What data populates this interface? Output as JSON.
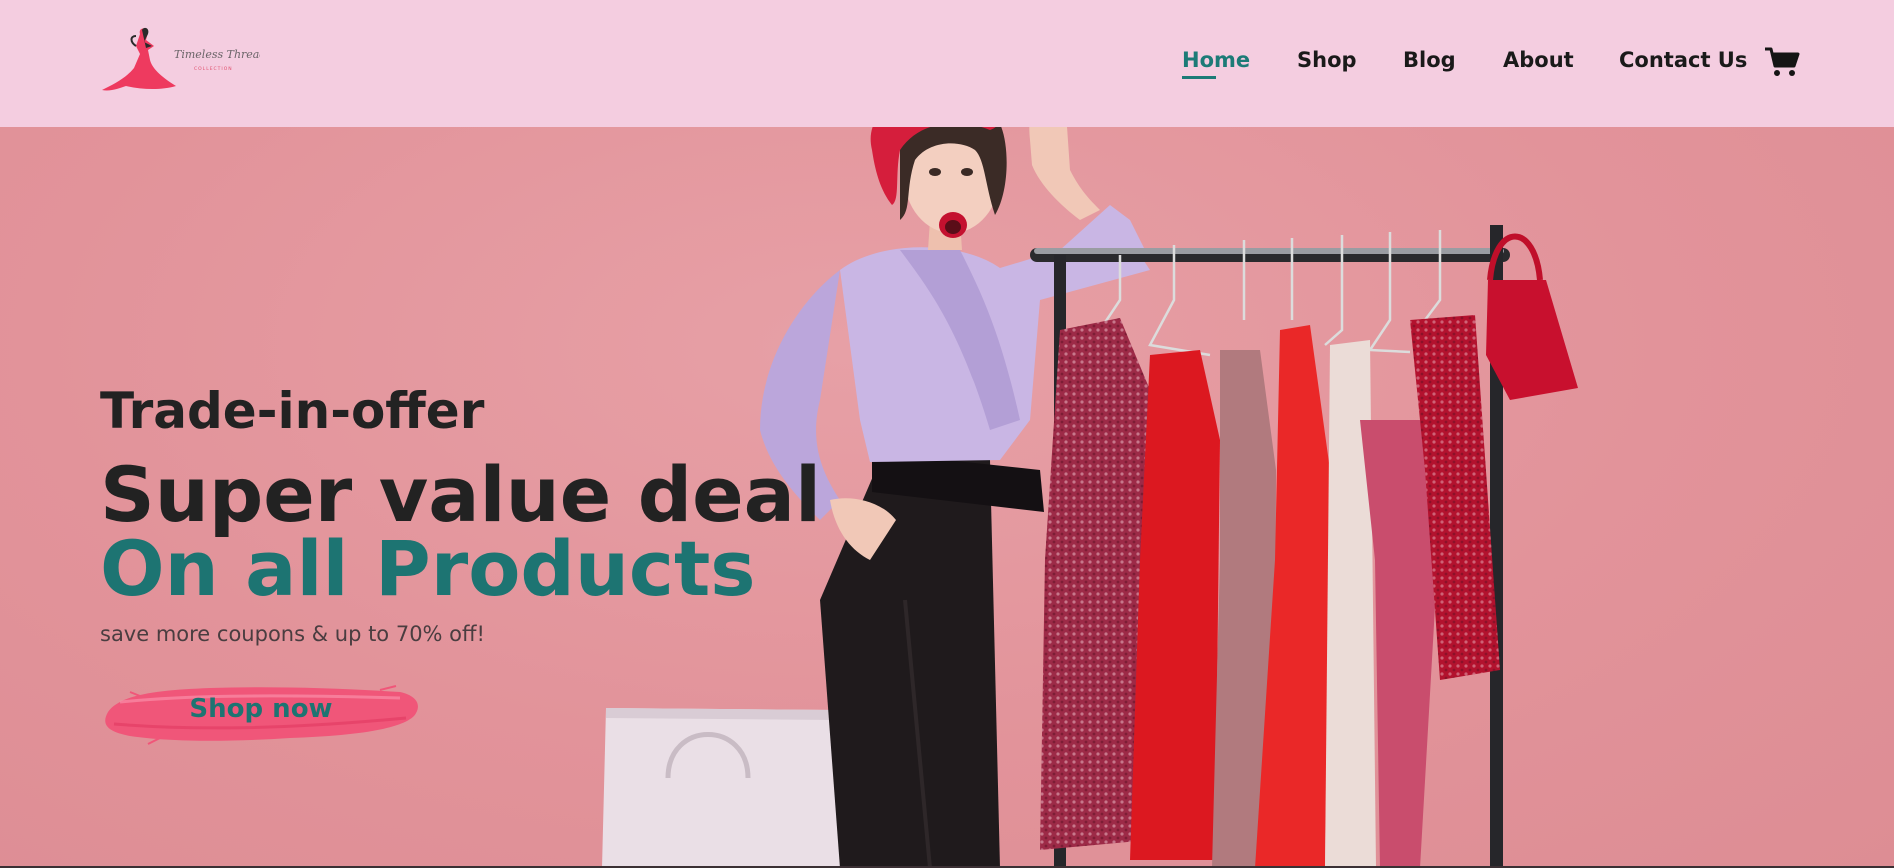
{
  "brand": {
    "name": "Timeless Threads",
    "tagline": "COLLECTION"
  },
  "nav": {
    "items": [
      {
        "label": "Home",
        "active": true
      },
      {
        "label": "Shop",
        "active": false
      },
      {
        "label": "Blog",
        "active": false
      },
      {
        "label": "About",
        "active": false
      },
      {
        "label": "Contact Us",
        "active": false
      }
    ],
    "cart_icon": "shopping-cart-icon"
  },
  "hero": {
    "eyebrow": "Trade-in-offer",
    "headline": "Super value deal",
    "highlight": "On all Products",
    "subtext": "save more coupons & up to 70% off!",
    "cta_label": "Shop now"
  },
  "colors": {
    "header_bg": "#f4cde0",
    "accent": "#1d7472",
    "hero_bg": "#e3949b",
    "cta_brush": "#f05679"
  }
}
